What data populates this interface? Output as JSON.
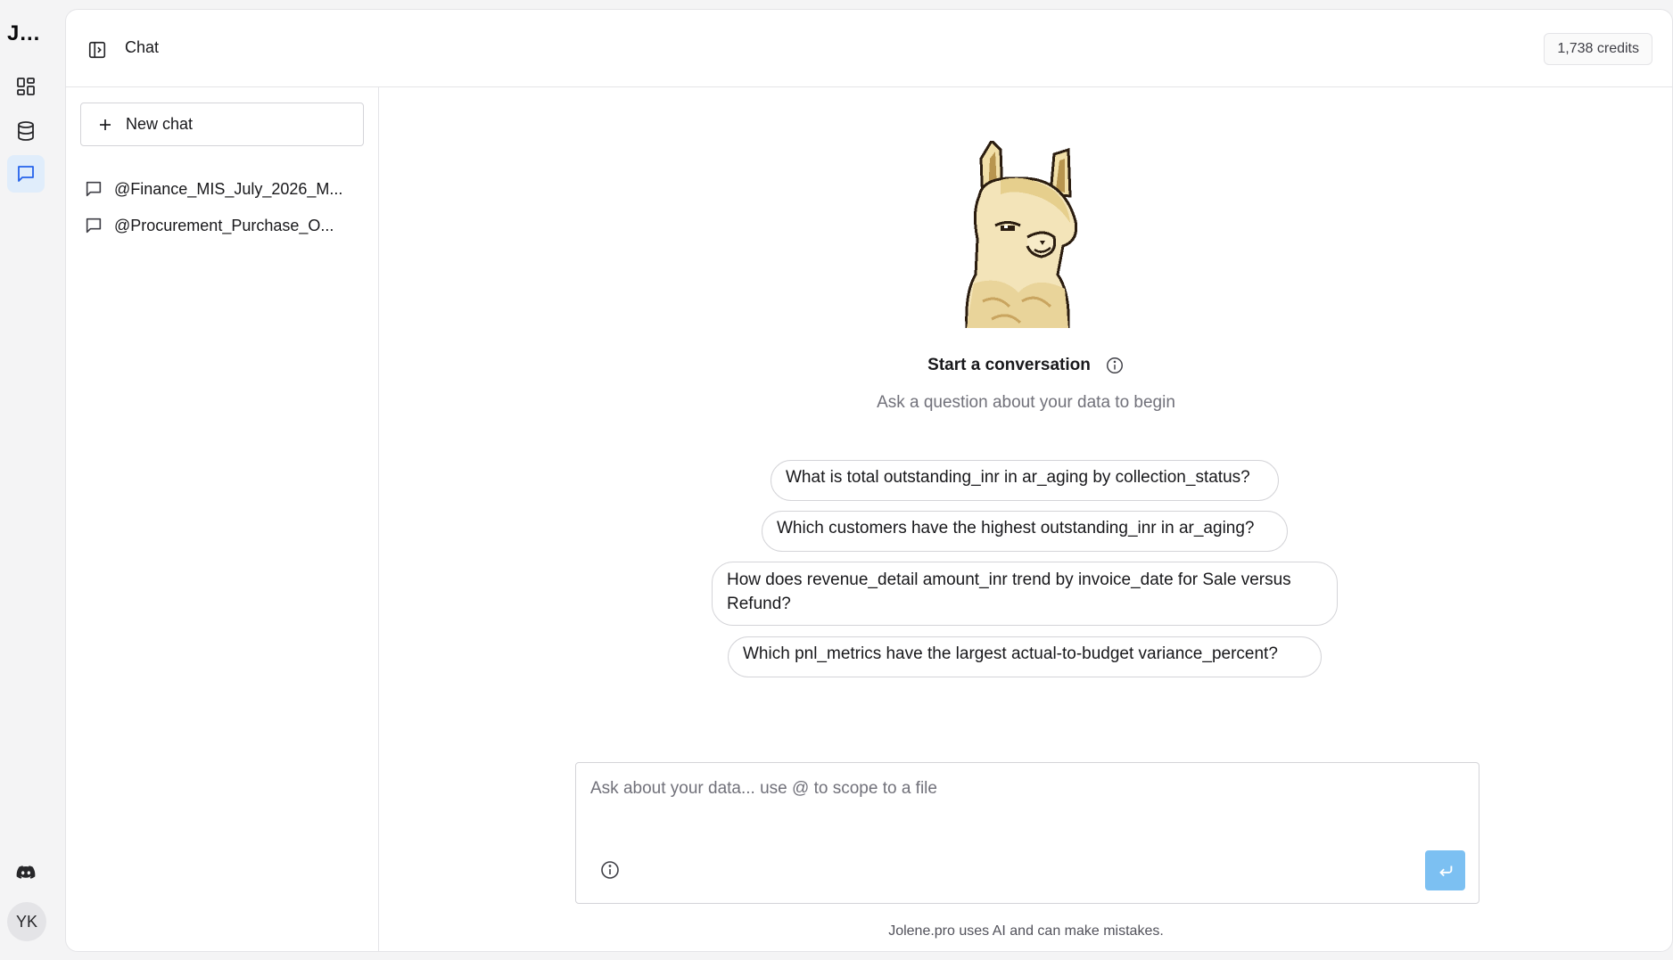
{
  "app": {
    "brand": "J...",
    "user_initials": "YK"
  },
  "rail": {
    "items": [
      {
        "icon": "dashboard-icon",
        "active": false
      },
      {
        "icon": "database-icon",
        "active": false
      },
      {
        "icon": "chat-icon",
        "active": true
      }
    ],
    "bottom_icon": "discord-icon"
  },
  "header": {
    "title": "Chat",
    "credits": "1,738 credits"
  },
  "sidebar": {
    "new_chat_label": "New chat",
    "chats": [
      {
        "label": "@Finance_MIS_July_2026_M..."
      },
      {
        "label": "@Procurement_Purchase_O..."
      }
    ]
  },
  "main": {
    "title": "Start a conversation",
    "subtitle": "Ask a question about your data to begin",
    "suggestions": [
      "What is total outstanding_inr in ar_aging by collection_status?",
      "Which customers have the highest outstanding_inr in ar_aging?",
      "How does revenue_detail amount_inr trend by invoice_date for Sale versus Refund?",
      "Which pnl_metrics have the largest actual-to-budget variance_percent?"
    ]
  },
  "composer": {
    "placeholder": "Ask about your data... use @ to scope to a file",
    "value": ""
  },
  "footer": {
    "disclaimer": "Jolene.pro uses AI and can make mistakes."
  },
  "colors": {
    "accent": "#2563eb",
    "active_bg": "#e0edfb",
    "send_button": "#7cc0f2"
  }
}
